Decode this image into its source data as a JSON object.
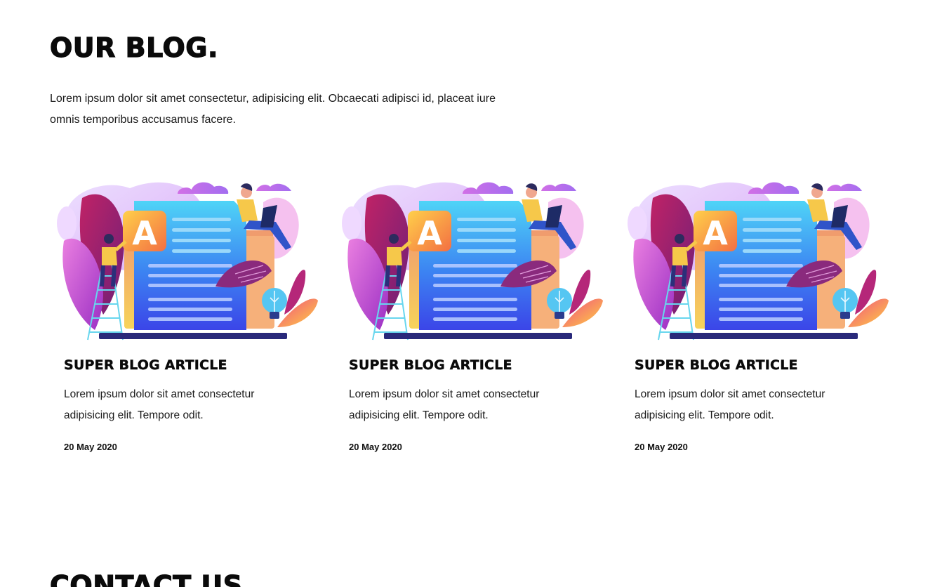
{
  "blog": {
    "title": "OUR BLOG.",
    "intro": "Lorem ipsum dolor sit amet consectetur, adipisicing elit. Obcaecati adipisci id, placeat iure omnis temporibus accusamus facere.",
    "cards": [
      {
        "illustration_icon": "blog-illustration",
        "badge_letter": "A",
        "title": "SUPER BLOG ARTICLE",
        "text": "Lorem ipsum dolor sit amet consectetur adipisicing elit. Tempore odit.",
        "date": "20 May 2020"
      },
      {
        "illustration_icon": "blog-illustration",
        "badge_letter": "A",
        "title": "SUPER BLOG ARTICLE",
        "text": "Lorem ipsum dolor sit amet consectetur adipisicing elit. Tempore odit.",
        "date": "20 May 2020"
      },
      {
        "illustration_icon": "blog-illustration",
        "badge_letter": "A",
        "title": "SUPER BLOG ARTICLE",
        "text": "Lorem ipsum dolor sit amet consectetur adipisicing elit. Tempore odit.",
        "date": "20 May 2020"
      }
    ]
  },
  "contact": {
    "title": "CONTACT US"
  },
  "colors": {
    "text": "#111111",
    "background": "#ffffff",
    "accent_purple": "#b84fd6",
    "accent_blue": "#3a6cf0",
    "accent_cyan": "#52d6f5",
    "accent_yellow": "#f6c84a",
    "accent_magenta": "#c2207a"
  }
}
